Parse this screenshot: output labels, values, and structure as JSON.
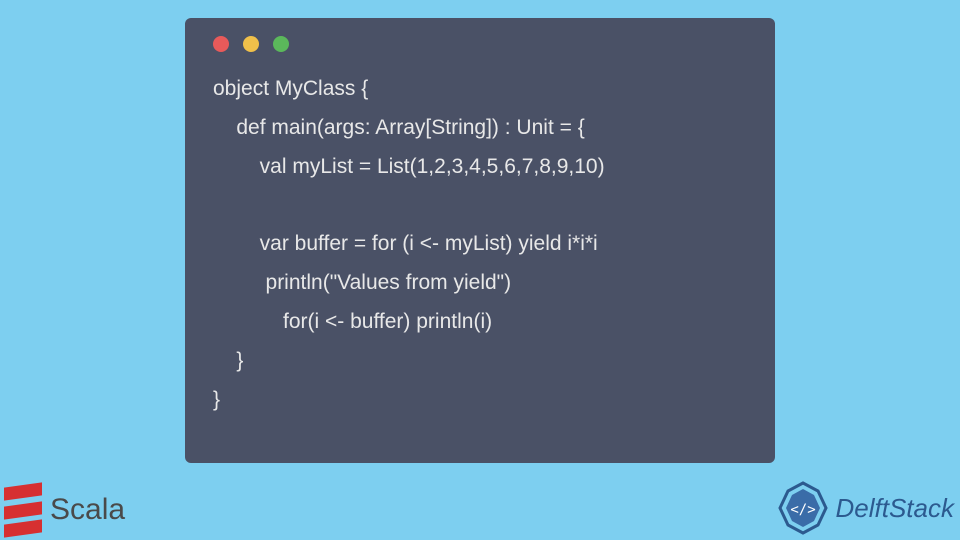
{
  "code": {
    "line1": "object MyClass {",
    "line2": "    def main(args: Array[String]) : Unit = {",
    "line3": "        val myList = List(1,2,3,4,5,6,7,8,9,10)",
    "line4": "",
    "line5": "        var buffer = for (i <- myList) yield i*i*i",
    "line6": "         println(\"Values from yield\")",
    "line7": "            for(i <- buffer) println(i)",
    "line8": "    }",
    "line9": "}"
  },
  "logos": {
    "scala": "Scala",
    "delft": "DelftStack"
  }
}
